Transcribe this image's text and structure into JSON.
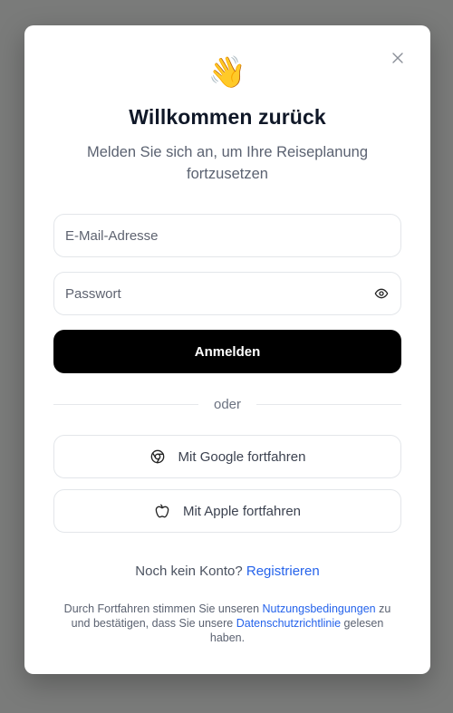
{
  "modal": {
    "emoji": "👋",
    "title": "Willkommen zurück",
    "subtitle": "Melden Sie sich an, um Ihre Reiseplanung fortzusetzen",
    "close_icon": "close-icon"
  },
  "form": {
    "email_placeholder": "E-Mail-Adresse",
    "email_value": "",
    "password_placeholder": "Passwort",
    "password_value": "",
    "password_toggle_icon": "eye-icon",
    "submit_label": "Anmelden"
  },
  "divider": {
    "label": "oder"
  },
  "social": {
    "google_label": "Mit Google fortfahren",
    "google_icon": "google-chrome-icon",
    "apple_label": "Mit Apple fortfahren",
    "apple_icon": "apple-icon"
  },
  "signup": {
    "prompt": "Noch kein Konto?",
    "link": "Registrieren"
  },
  "legal": {
    "part1": "Durch Fortfahren stimmen Sie unseren ",
    "terms_link": "Nutzungsbedingungen",
    "part2": " zu und bestätigen, dass Sie unsere ",
    "privacy_link": "Datenschutzrichtlinie",
    "part3": " gelesen haben."
  },
  "colors": {
    "backdrop": "#7a7b7a",
    "primary_button": "#000000",
    "link": "#2563eb",
    "title": "#101828"
  }
}
